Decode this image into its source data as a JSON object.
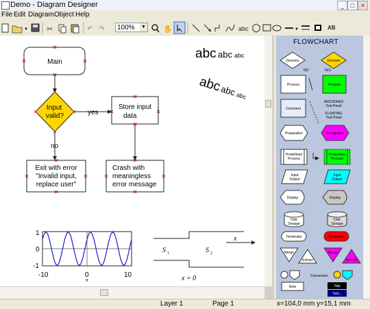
{
  "window": {
    "title": "Demo - Diagram Designer",
    "controls": [
      "_",
      "□",
      "×"
    ]
  },
  "menu": [
    "File",
    "Edit",
    "Diagram",
    "Object",
    "Help"
  ],
  "toolbar": {
    "zoom": "100%"
  },
  "canvas": {
    "flowchart": {
      "main": "Main",
      "decision": [
        "Input",
        "valid?"
      ],
      "yes": "yes",
      "no": "no",
      "store": [
        "Store input",
        "data"
      ],
      "exit": [
        "Exit with error",
        "\"Invalid input,",
        "replace user\""
      ],
      "crash": [
        "Crash with",
        "meaningless",
        "error message"
      ]
    },
    "text_samples": {
      "straight": [
        "abc",
        "abc",
        "abc"
      ],
      "rotated": [
        "abc",
        "abc",
        "abc"
      ]
    },
    "sine_plot": {
      "y_ticks": [
        "1",
        "0",
        "-1"
      ],
      "x_ticks": [
        "-10",
        "0",
        "10"
      ],
      "x_sub": "π"
    },
    "channel": {
      "s1": "S",
      "s1_sub": "1",
      "s2": "S",
      "s2_sub": "2",
      "x": "x",
      "x0": "x = 0"
    }
  },
  "palette": {
    "title": "FLOWCHART",
    "labels": {
      "decision": "Decision",
      "no": "NO",
      "yes": "YES",
      "process": "Process",
      "comment": "Comment",
      "anchored": [
        "ANCHORED",
        "Text Panel"
      ],
      "floating": [
        "FLOATING",
        "Text Panel"
      ],
      "preparation": "Preparation",
      "predefined": [
        "Predefined",
        "Process"
      ],
      "input": [
        "Input",
        "Output"
      ],
      "display": "Display",
      "disk": [
        "Disk",
        "Storage"
      ],
      "terminator": "Terminator",
      "merge": "Merge",
      "extract": "Extract",
      "connectors": "Connectors",
      "note": "Note",
      "title": "Title",
      "text": "Text..."
    },
    "colors": {
      "accent": "#00ff00",
      "decision": "#ffd700",
      "magenta": "#ff00ff",
      "cyan": "#00ffff",
      "red": "#ff0000"
    }
  },
  "status": {
    "layer": "Layer 1",
    "page": "Page 1",
    "coords": "x=104,0 mm  y=15,1 mm"
  }
}
